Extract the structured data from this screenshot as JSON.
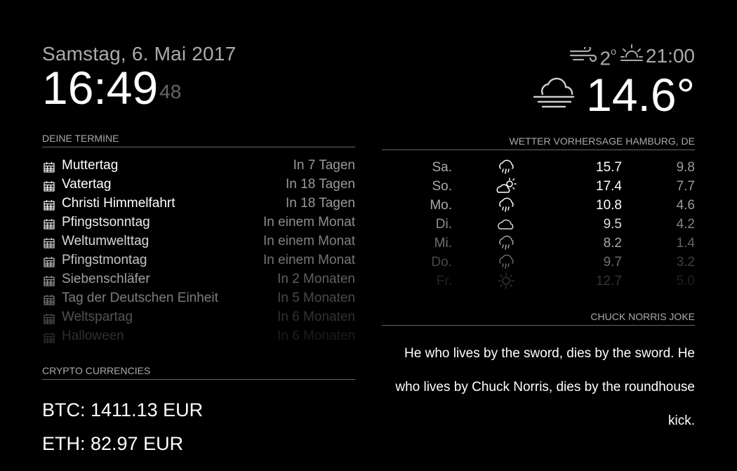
{
  "clock": {
    "date": "Samstag, 6. Mai 2017",
    "time": "16:49",
    "seconds": "48"
  },
  "calendar": {
    "header": "DEINE TERMINE",
    "icon": "calendar-icon",
    "events": [
      {
        "title": "Muttertag",
        "when": "In 7 Tagen",
        "opacity": 1.0
      },
      {
        "title": "Vatertag",
        "when": "In 18 Tagen",
        "opacity": 1.0
      },
      {
        "title": "Christi Himmelfahrt",
        "when": "In 18 Tagen",
        "opacity": 1.0
      },
      {
        "title": "Pfingstsonntag",
        "when": "In einem Monat",
        "opacity": 0.92
      },
      {
        "title": "Weltumwelttag",
        "when": "In einem Monat",
        "opacity": 0.84
      },
      {
        "title": "Pfingstmontag",
        "when": "In einem Monat",
        "opacity": 0.76
      },
      {
        "title": "Siebenschläfer",
        "when": "In 2 Monaten",
        "opacity": 0.62
      },
      {
        "title": "Tag der Deutschen Einheit",
        "when": "In 5 Monaten",
        "opacity": 0.48
      },
      {
        "title": "Weltspartag",
        "when": "In 6 Monaten",
        "opacity": 0.32
      },
      {
        "title": "Halloween",
        "when": "In 6 Monaten",
        "opacity": 0.18
      }
    ]
  },
  "crypto": {
    "header": "CRYPTO CURRENCIES",
    "lines": [
      "BTC: 1411.13 EUR",
      "ETH: 82.97 EUR"
    ]
  },
  "current_weather": {
    "wind_icon": "wind-icon",
    "beaufort": "2",
    "beaufort_unit": "o",
    "sun_icon": "sunset-icon",
    "sun_time": "21:00",
    "condition_icon": "fog-cloud-icon",
    "temperature": "14.6°"
  },
  "forecast": {
    "header": "WETTER VORHERSAGE HAMBURG, DE",
    "days": [
      {
        "day": "Sa.",
        "icon": "rain-icon",
        "max": "15.7",
        "min": "9.8",
        "opacity": 1.0
      },
      {
        "day": "So.",
        "icon": "partly-cloudy-icon",
        "max": "17.4",
        "min": "7.7",
        "opacity": 1.0
      },
      {
        "day": "Mo.",
        "icon": "rain-icon",
        "max": "10.8",
        "min": "4.6",
        "opacity": 1.0
      },
      {
        "day": "Di.",
        "icon": "cloud-icon",
        "max": "9.5",
        "min": "4.2",
        "opacity": 0.85
      },
      {
        "day": "Mi.",
        "icon": "rain-icon",
        "max": "8.2",
        "min": "1.4",
        "opacity": 0.65
      },
      {
        "day": "Do.",
        "icon": "rain-icon",
        "max": "9.7",
        "min": "3.2",
        "opacity": 0.42
      },
      {
        "day": "Fr.",
        "icon": "sun-icon",
        "max": "12.7",
        "min": "5.0",
        "opacity": 0.2
      }
    ]
  },
  "joke": {
    "header": "CHUCK NORRIS JOKE",
    "text": "He who lives by the sword, dies by the sword. He who lives by Chuck Norris, dies by the roundhouse kick."
  }
}
